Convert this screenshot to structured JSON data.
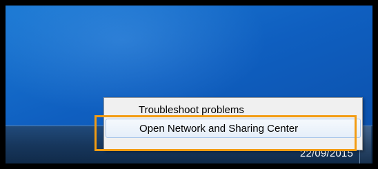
{
  "context_menu": {
    "items": [
      {
        "label": "Troubleshoot problems"
      },
      {
        "label": "Open Network and Sharing Center"
      }
    ]
  },
  "taskbar": {
    "date": "22/09/2015"
  },
  "icons": {
    "tray_arrow": "chevron-up-icon",
    "tray_flag": "action-center-flag-icon",
    "tray_monitor": "monitor-icon",
    "tray_battery": "battery-icon",
    "tray_network": "network-icon",
    "tray_volume": "volume-icon"
  },
  "colors": {
    "highlight": "#f39c12",
    "desktop": "#1b79d4",
    "taskbar": "#17375d"
  }
}
